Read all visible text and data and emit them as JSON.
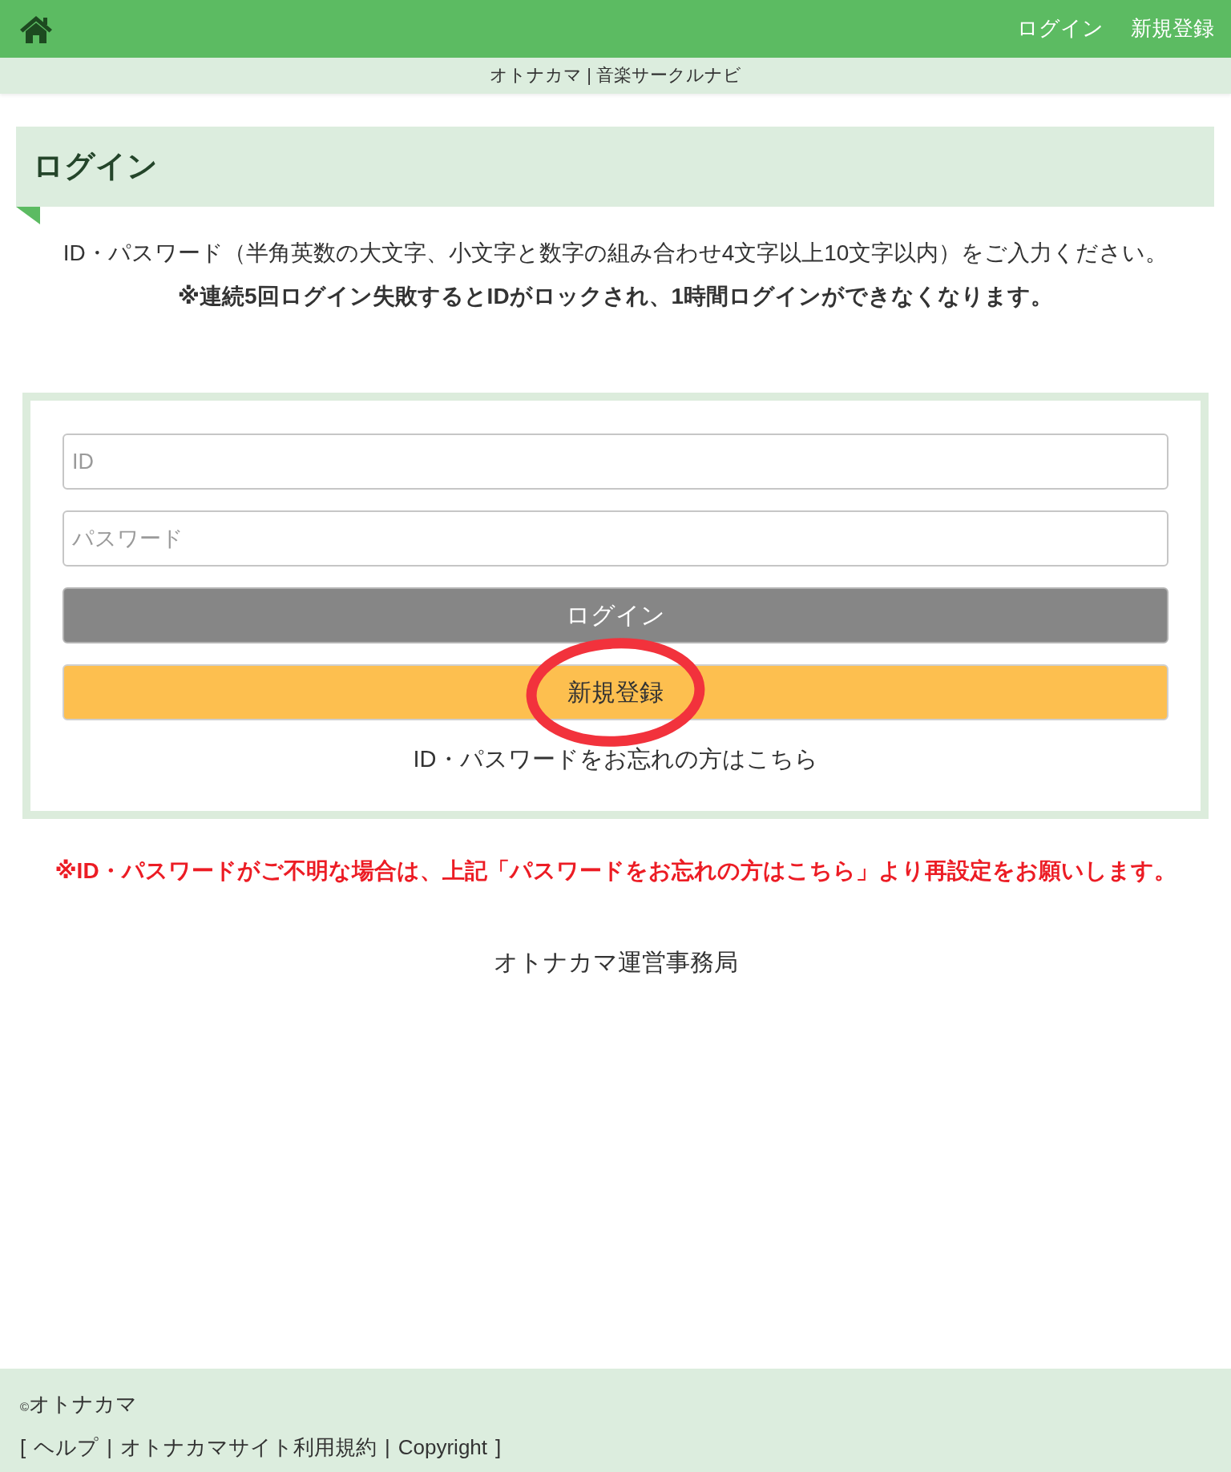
{
  "header": {
    "links": [
      {
        "label": "ログイン"
      },
      {
        "label": "新規登録"
      }
    ]
  },
  "site_title": "オトナカマ | 音楽サークルナビ",
  "page_heading": "ログイン",
  "instructions": "ID・パスワード（半角英数の大文字、小文字と数字の組み合わせ4文字以上10文字以内）をご入力ください。",
  "warning": "※連続5回ログイン失敗するとIDがロックされ、1時間ログインができなくなります。",
  "form": {
    "fields": [
      {
        "placeholder": "ID"
      },
      {
        "placeholder": "パスワード"
      }
    ],
    "buttons": [
      {
        "label": "ログイン",
        "kind": "submit",
        "circled": false
      },
      {
        "label": "新規登録",
        "kind": "register",
        "circled": true
      }
    ],
    "forgot_link": "ID・パスワードをお忘れの方はこちら"
  },
  "notice": "※ID・パスワードがご不明な場合は、上記「パスワードをお忘れの方はこちら」より再設定をお願いします。",
  "office": "オトナカマ運営事務局",
  "footer": {
    "copyright": {
      "symbol": "©",
      "holder": "オトナカマ"
    },
    "open_bracket": "[",
    "links": [
      "ヘルプ",
      "オトナカマサイト利用規約",
      "Copyright"
    ],
    "separators": [
      "|",
      "|"
    ],
    "close_bracket": "]"
  }
}
